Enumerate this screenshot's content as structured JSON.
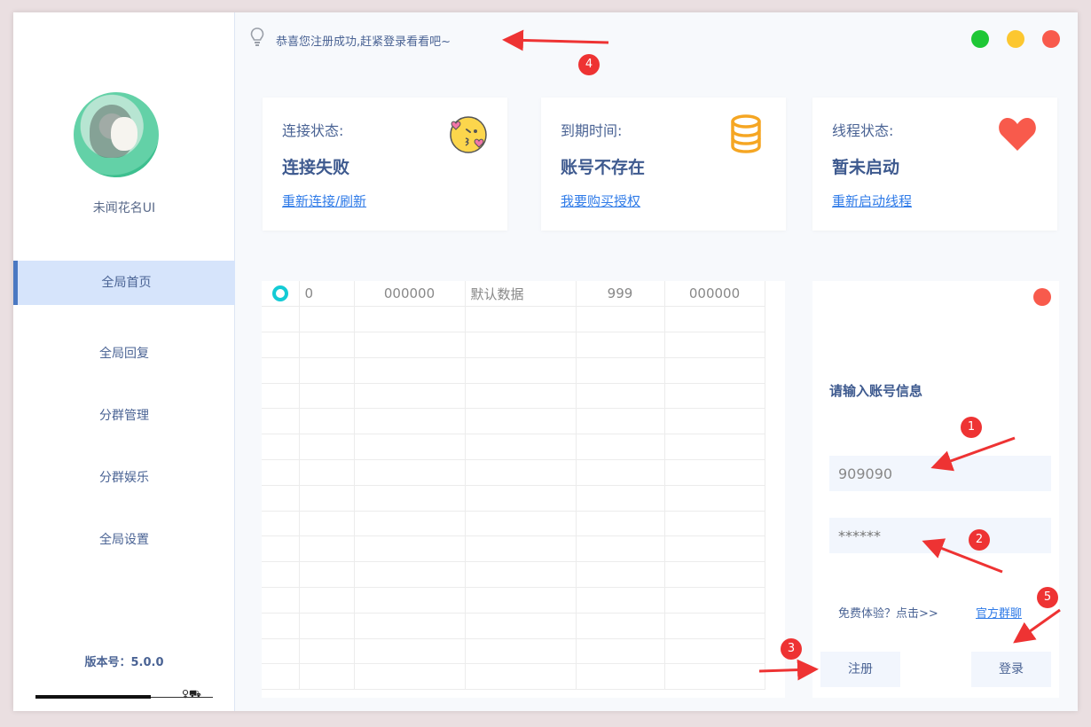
{
  "sidebar": {
    "username": "未闻花名UI",
    "items": [
      {
        "label": "全局首页",
        "active": true
      },
      {
        "label": "全局回复",
        "active": false
      },
      {
        "label": "分群管理",
        "active": false
      },
      {
        "label": "分群娱乐",
        "active": false
      },
      {
        "label": "全局设置",
        "active": false
      }
    ],
    "version": "版本号：5.0.0"
  },
  "topbar": {
    "notice": "恭喜您注册成功,赶紧登录看看吧~",
    "window_controls": [
      "#1ec735",
      "#fcc730",
      "#f85a4c"
    ]
  },
  "cards": [
    {
      "label": "连接状态:",
      "value": "连接失败",
      "link": "重新连接/刷新",
      "icon": "kiss-emoji-icon"
    },
    {
      "label": "到期时间:",
      "value": "账号不存在",
      "link": "我要购买授权",
      "icon": "database-icon"
    },
    {
      "label": "线程状态:",
      "value": "暂未启动",
      "link": "重新启动线程",
      "icon": "heart-icon"
    }
  ],
  "table": {
    "row": [
      "0",
      "000000",
      "默认数据",
      "999",
      "000000"
    ]
  },
  "login": {
    "title": "请输入账号信息",
    "account_value": "909090",
    "password_placeholder": "******",
    "trial_text": "免费体验？点击>>",
    "group_link": "官方群聊",
    "register_label": "注册",
    "login_label": "登录"
  },
  "annotations": [
    "1",
    "2",
    "3",
    "4",
    "5"
  ],
  "colors": {
    "accent": "#2f7be8",
    "primary_text": "#4a6394",
    "active_nav": "#d6e4fb",
    "annotation": "#ee3333"
  }
}
